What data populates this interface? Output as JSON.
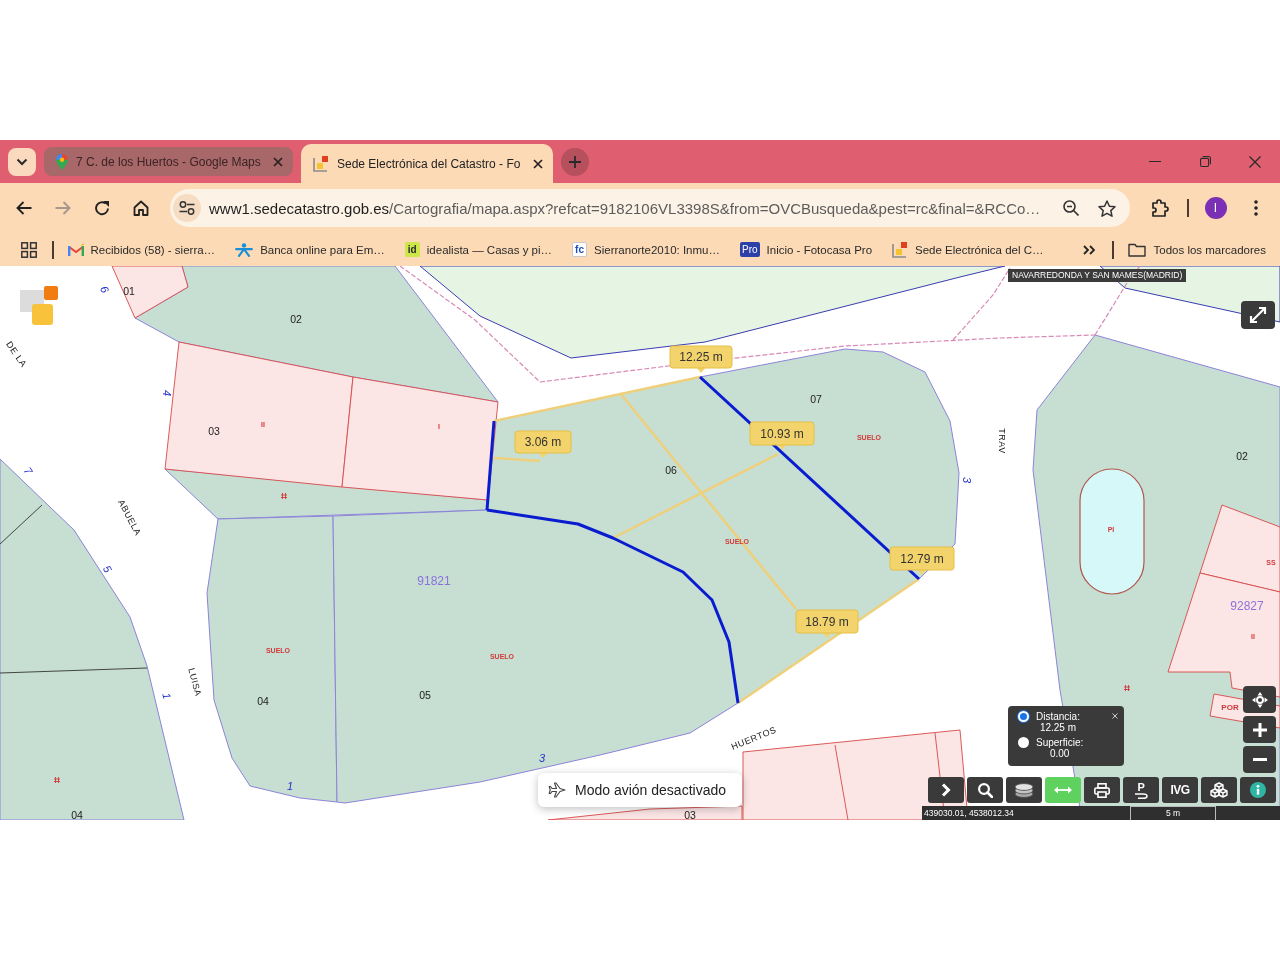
{
  "tabs": [
    {
      "kind": "maps",
      "title": "7 C. de los Huertos - Google Maps",
      "selected": false
    },
    {
      "kind": "catastro",
      "title": "Sede Electrónica del Catastro - Fo",
      "selected": true
    }
  ],
  "nav_buttons": [
    {
      "kind": "back",
      "disabled": false
    },
    {
      "kind": "forward",
      "disabled": true
    },
    {
      "kind": "reload",
      "disabled": false
    },
    {
      "kind": "home",
      "disabled": false
    }
  ],
  "address_bar": {
    "host": "www1.sedecatastro.gob.es",
    "path": "/Cartografia/mapa.aspx?refcat=9182106VL3398S&from=OVCBusqueda&pest=rc&final=&RCCo…"
  },
  "profile": {
    "initial": "I"
  },
  "bookmarks": [
    {
      "kind": "gmail",
      "label": "Recibidos (58) - sierra…"
    },
    {
      "kind": "bank",
      "label": "Banca online para Em…"
    },
    {
      "kind": "id",
      "icon_text": "id",
      "label": "idealista — Casas y pi…"
    },
    {
      "kind": "fc",
      "icon_text": "fc",
      "label": "Sierranorte2010: Inmu…"
    },
    {
      "kind": "pro",
      "icon_text": "Pro",
      "label": "Inicio - Fotocasa Pro"
    },
    {
      "kind": "catastro",
      "label": "Sede Electrónica del C…"
    }
  ],
  "all_bookmarks": {
    "label": "Todos los marcadores"
  },
  "map": {
    "region": "NAVARREDONDA Y SAN MAMES(MADRID)",
    "parcel_numbers": [
      "01",
      "02",
      "03",
      "04",
      "05",
      "06",
      "07",
      "02",
      "03",
      "04"
    ],
    "block_numbers": [
      "91821",
      "92827"
    ],
    "street_names": [
      "DE LA",
      "ABUELA",
      "LUISA",
      "HUERTOS",
      "TRAV"
    ],
    "house_numbers": [
      "6",
      "4",
      "7",
      "5",
      "1",
      "1",
      "3",
      "3"
    ],
    "use_labels": [
      "II",
      "I",
      "SUELO",
      "SUELO",
      "SUELO",
      "SUELO",
      "PI",
      "SS",
      "II",
      "POR"
    ],
    "measurements": [
      "12.25 m",
      "3.06 m",
      "10.93 m",
      "12.79 m",
      "18.79 m"
    ]
  },
  "measure_panel": {
    "options": [
      {
        "label": "Distancia:",
        "value": "12.25 m",
        "selected": true
      },
      {
        "label": "Superficie:",
        "value": "0.00",
        "selected": false
      }
    ]
  },
  "map_tools": [
    {
      "kind": "chevron",
      "selected": false
    },
    {
      "kind": "search",
      "selected": false
    },
    {
      "kind": "layers",
      "selected": false
    },
    {
      "kind": "measure",
      "selected": true
    },
    {
      "kind": "print",
      "selected": false
    },
    {
      "kind": "parking",
      "icon_text": "P",
      "selected": false
    },
    {
      "kind": "text",
      "label": "IVG",
      "selected": false
    },
    {
      "kind": "cubes",
      "selected": false
    },
    {
      "kind": "info",
      "selected": false
    }
  ],
  "status_bar": {
    "coordinates": "439030.01, 4538012.34",
    "scale": "5 m"
  },
  "toast": {
    "text": "Modo avión desactivado"
  }
}
